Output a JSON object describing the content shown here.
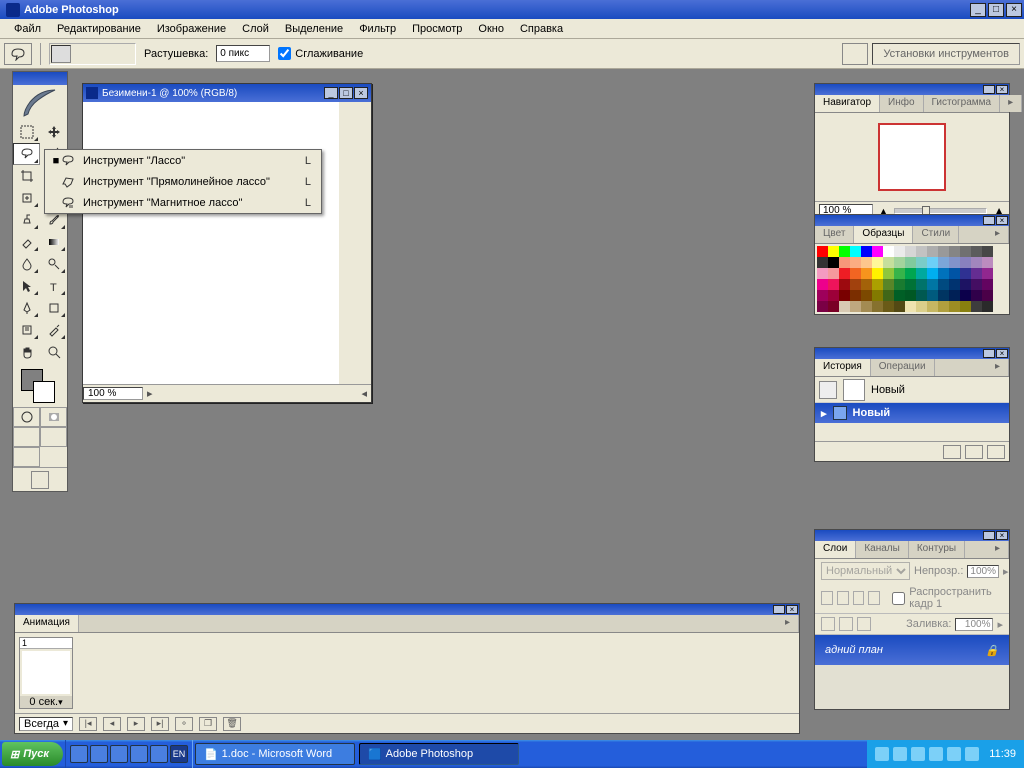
{
  "app": {
    "title": "Adobe Photoshop"
  },
  "menu": [
    "Файл",
    "Редактирование",
    "Изображение",
    "Слой",
    "Выделение",
    "Фильтр",
    "Просмотр",
    "Окно",
    "Справка"
  ],
  "options": {
    "feather_label": "Растушевка:",
    "feather_value": "0 пикс",
    "antialias_label": "Сглаживание",
    "presets_label": "Установки инструментов"
  },
  "doc": {
    "title": "Безимени-1 @ 100% (RGB/8)",
    "zoom": "100 %"
  },
  "flyout": {
    "items": [
      {
        "marker": "■",
        "label": "Инструмент \"Лассо\"",
        "key": "L"
      },
      {
        "marker": "",
        "label": "Инструмент \"Прямолинейное лассо\"",
        "key": "L"
      },
      {
        "marker": "",
        "label": "Инструмент \"Магнитное лассо\"",
        "key": "L"
      }
    ]
  },
  "navigator": {
    "tabs": [
      "Навигатор",
      "Инфо",
      "Гистограмма"
    ],
    "zoom": "100 %"
  },
  "swatches": {
    "tabs": [
      "Цвет",
      "Образцы",
      "Стили"
    ],
    "colors": [
      "#ff0000",
      "#ffff00",
      "#00ff00",
      "#00ffff",
      "#0000ff",
      "#ff00ff",
      "#ffffff",
      "#ebebeb",
      "#d6d6d6",
      "#c2c2c2",
      "#adadad",
      "#999999",
      "#858585",
      "#707070",
      "#5c5c5c",
      "#474747",
      "#333333",
      "#000000",
      "#f7977a",
      "#fbad82",
      "#fdc68c",
      "#fff799",
      "#c6df9c",
      "#a4d49d",
      "#81ca9d",
      "#7accc8",
      "#6ccff7",
      "#7ca6d8",
      "#8293ca",
      "#8881be",
      "#a286bd",
      "#bc8cbf",
      "#f49bc1",
      "#f5999d",
      "#ee1d24",
      "#f16522",
      "#f7941d",
      "#fff100",
      "#8fc63d",
      "#37b44a",
      "#00a650",
      "#00a99e",
      "#00aeef",
      "#0072bc",
      "#0054a5",
      "#2f3192",
      "#652d92",
      "#91278f",
      "#ed008c",
      "#ee145b",
      "#9d0a0f",
      "#a1410d",
      "#a36209",
      "#aba000",
      "#588528",
      "#197b30",
      "#007236",
      "#00736a",
      "#0076a4",
      "#004a80",
      "#003370",
      "#1d1363",
      "#440e62",
      "#630460",
      "#9e005b",
      "#9d0039",
      "#790000",
      "#7b2e00",
      "#7c4900",
      "#827a00",
      "#406618",
      "#005f26",
      "#005824",
      "#005951",
      "#005b7e",
      "#003562",
      "#002056",
      "#0c004b",
      "#30004a",
      "#4b0048",
      "#7a0045",
      "#7a0026",
      "#d8cab3",
      "#bfa87f",
      "#a38b52",
      "#86712e",
      "#6a5a17",
      "#534914",
      "#efe3af",
      "#dbcf8a",
      "#c6b762",
      "#b09f3e",
      "#9c8d23",
      "#88800f",
      "#3d3d3d",
      "#2a2a2a"
    ]
  },
  "history": {
    "tabs": [
      "История",
      "Операции"
    ],
    "snapshot": "Новый",
    "step": "Новый"
  },
  "layers": {
    "tabs": [
      "Слои",
      "Каналы",
      "Контуры"
    ],
    "mode": "Нормальный",
    "opacity_label": "Непрозр.:",
    "opacity_value": "100%",
    "spread_label": "Распространить кадр 1",
    "fill_label": "Заливка:",
    "fill_value": "100%",
    "layer_name": "адний план"
  },
  "animation": {
    "tab": "Анимация",
    "frame_number": "1",
    "frame_duration": "0 сек.",
    "loop": "Всегда"
  },
  "taskbar": {
    "start": "Пуск",
    "items": [
      {
        "label": "1.doc - Microsoft Word",
        "active": false
      },
      {
        "label": "Adobe Photoshop",
        "active": true
      }
    ],
    "clock": "11:39"
  }
}
